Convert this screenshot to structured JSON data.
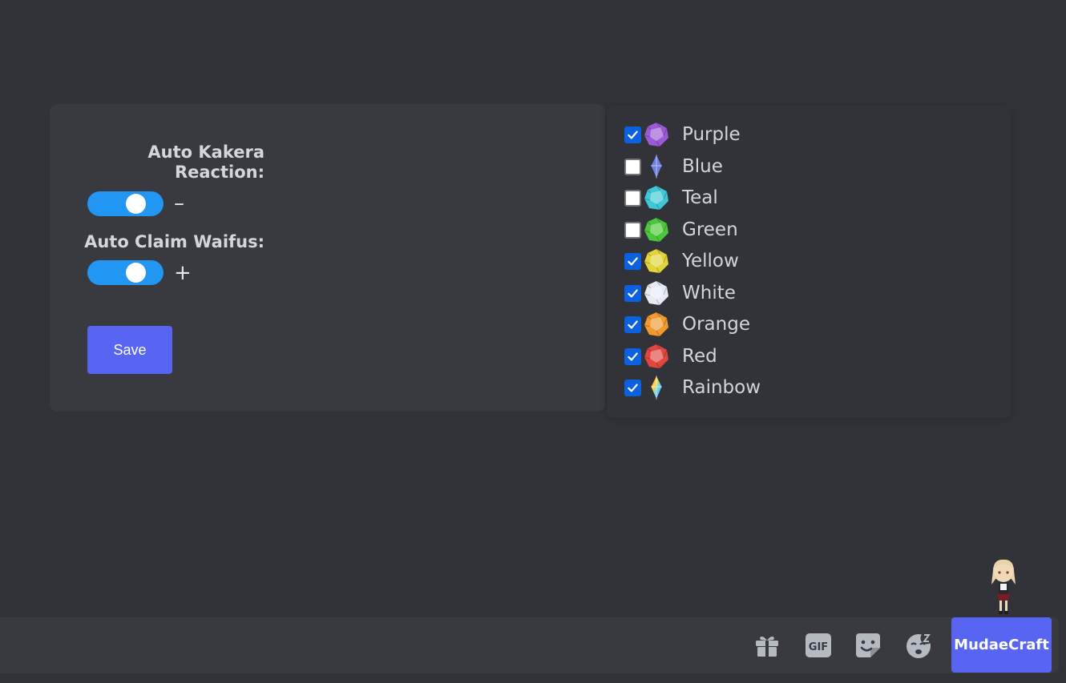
{
  "settings": {
    "auto_kakera_label_line1": "Auto Kakera",
    "auto_kakera_label_line2": "Reaction:",
    "auto_kakera_enabled": true,
    "auto_kakera_sign": "–",
    "auto_claim_label": "Auto Claim Waifus:",
    "auto_claim_enabled": true,
    "auto_claim_sign": "+",
    "save_label": "Save"
  },
  "kakera_list": [
    {
      "name": "Purple",
      "checked": true,
      "color": "#9b59d6"
    },
    {
      "name": "Blue",
      "checked": false,
      "color": "#6f7fe0"
    },
    {
      "name": "Teal",
      "checked": false,
      "color": "#3fc8d6"
    },
    {
      "name": "Green",
      "checked": false,
      "color": "#4cc63a"
    },
    {
      "name": "Yellow",
      "checked": true,
      "color": "#e3d43a"
    },
    {
      "name": "White",
      "checked": true,
      "color": "#e6ebf3"
    },
    {
      "name": "Orange",
      "checked": true,
      "color": "#ef9a2e"
    },
    {
      "name": "Red",
      "checked": true,
      "color": "#e0473f"
    },
    {
      "name": "Rainbow",
      "checked": true,
      "color": "#e667c8"
    }
  ],
  "toolbar": {
    "icons": [
      "gift-icon",
      "gif-icon",
      "sticker-icon",
      "emoji-icon"
    ],
    "gif_text": "GIF",
    "mudae_label": "MudaeCraft"
  },
  "colors": {
    "background": "#313338",
    "panel": "#383a40",
    "toggle_on": "#2196f3",
    "accent": "#5865f2",
    "checkbox_on": "#0b61e0"
  }
}
